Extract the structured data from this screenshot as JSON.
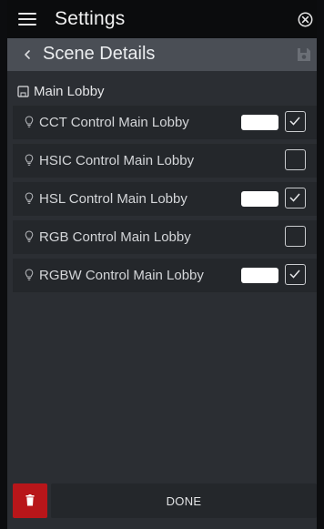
{
  "app_bar": {
    "title": "Settings",
    "menu_icon": "hamburger-menu-icon",
    "close_icon": "close-circle-icon"
  },
  "sub_header": {
    "title": "Scene Details",
    "back_icon": "chevron-left-icon",
    "save_icon": "save-disk-icon"
  },
  "group": {
    "label": "Main Lobby",
    "icon": "room-icon"
  },
  "devices": [
    {
      "label": "CCT Control Main Lobby",
      "icon": "bulb-icon",
      "has_color": true,
      "color": "#ffffff",
      "checked": true
    },
    {
      "label": "HSIC Control Main Lobby",
      "icon": "bulb-icon",
      "has_color": false,
      "checked": false
    },
    {
      "label": "HSL Control Main Lobby",
      "icon": "bulb-icon",
      "has_color": true,
      "color": "#ffffff",
      "checked": true
    },
    {
      "label": "RGB Control Main Lobby",
      "icon": "bulb-icon",
      "has_color": false,
      "checked": false
    },
    {
      "label": "RGBW Control Main Lobby",
      "icon": "bulb-icon",
      "has_color": true,
      "color": "#ffffff",
      "checked": true
    }
  ],
  "footer": {
    "delete_icon": "trash-icon",
    "done_label": "DONE"
  },
  "colors": {
    "delete": "#b8161a",
    "background": "#2b2e33",
    "row": "#24272b",
    "header": "#4a4e55",
    "app_bar": "#0b0c0d"
  }
}
